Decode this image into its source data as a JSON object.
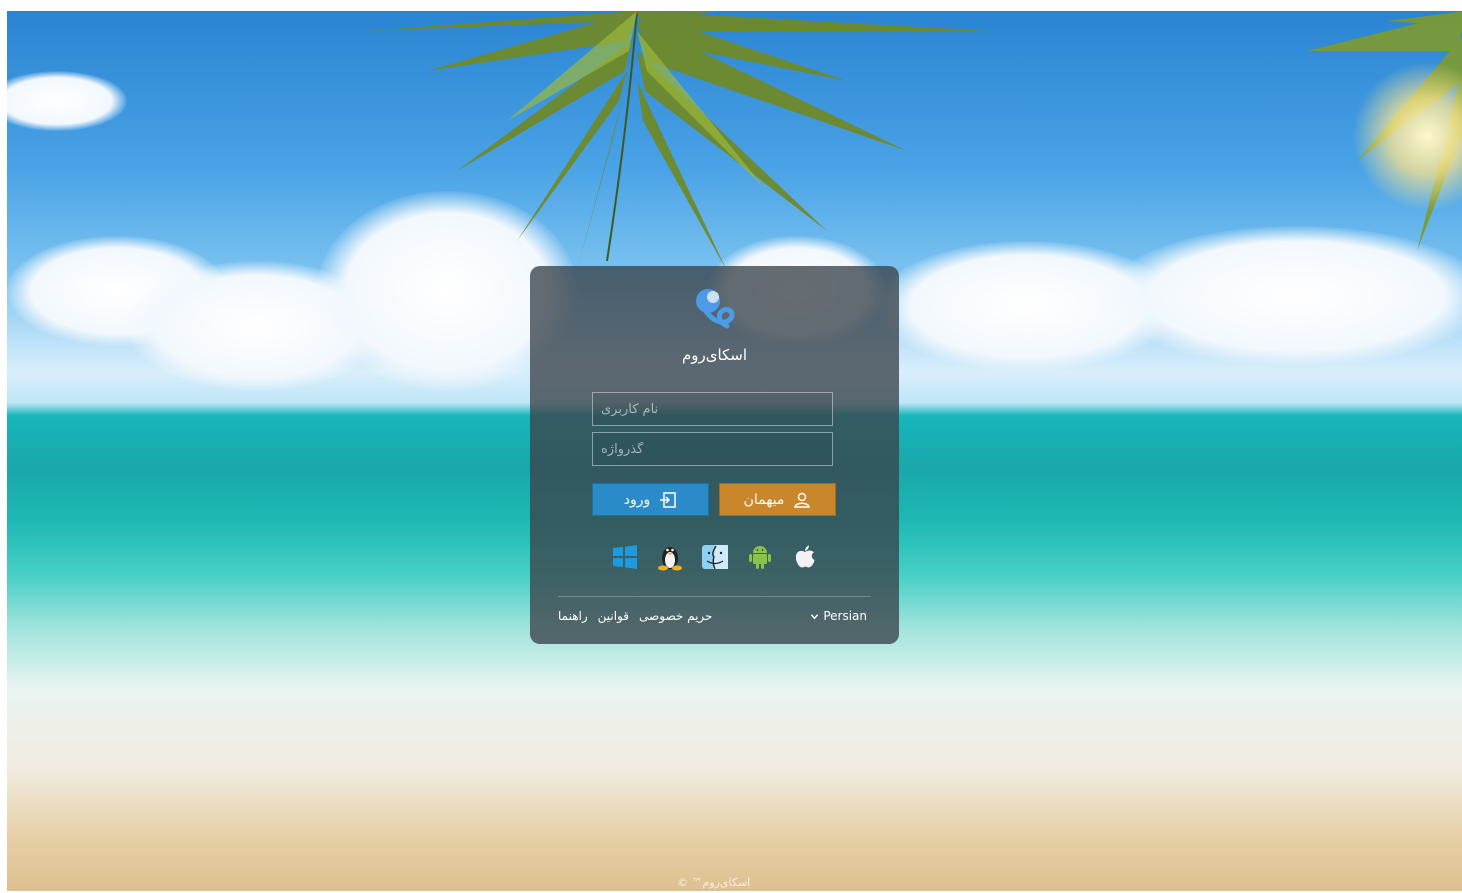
{
  "app": {
    "brand_name": "اسکای‌روم",
    "copyright": "اسکای‌روم™ ©"
  },
  "login": {
    "username_placeholder": "نام کاربری",
    "password_placeholder": "گذرواژه",
    "login_label": "ورود",
    "guest_label": "میهمان"
  },
  "platforms": [
    {
      "name": "windows-icon"
    },
    {
      "name": "linux-icon"
    },
    {
      "name": "macos-finder-icon"
    },
    {
      "name": "android-icon"
    },
    {
      "name": "apple-icon"
    }
  ],
  "footer": {
    "links": [
      "حریم خصوصی",
      "قوانین",
      "راهنما"
    ],
    "language": "Persian"
  },
  "colors": {
    "login_button": "#2b8ac8",
    "guest_button": "#c9862a",
    "card_background": "rgba(58,66,74,0.78)",
    "logo": "#3b8fe0"
  }
}
